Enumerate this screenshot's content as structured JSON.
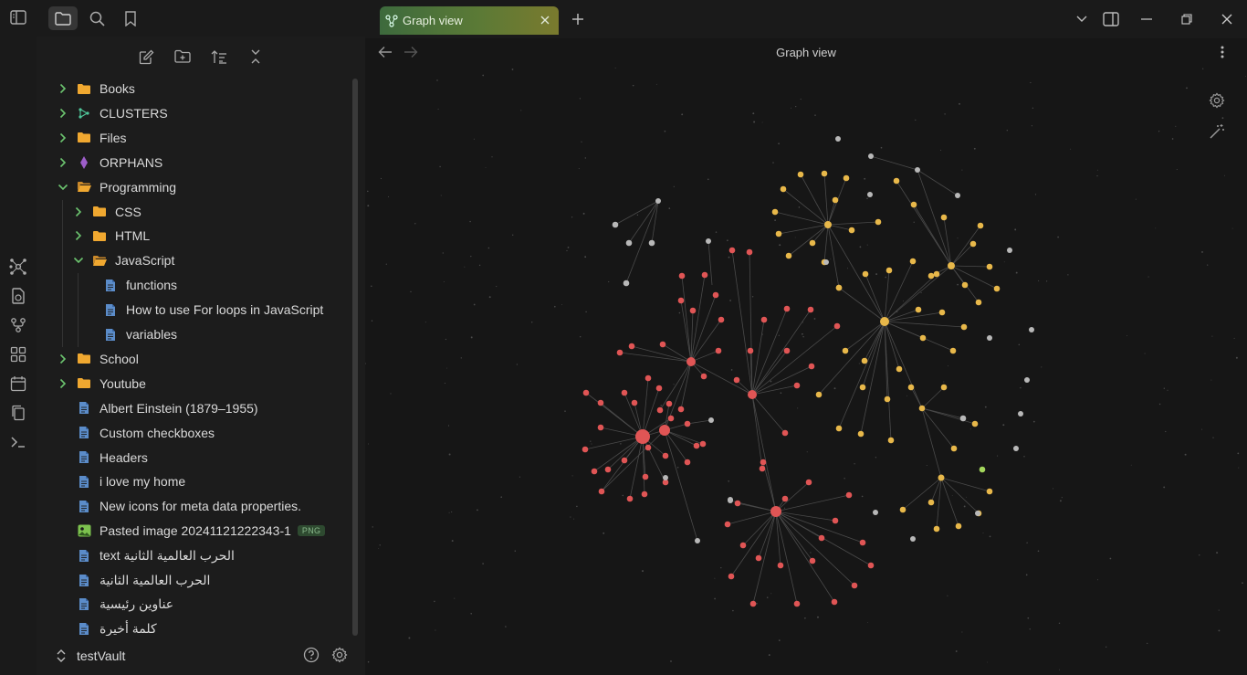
{
  "ribbon": {
    "icons": [
      "graph-view-icon",
      "file-recovery-icon",
      "canvas-icon",
      "templates-icon",
      "daily-notes-icon",
      "copy-icon",
      "command-palette-icon"
    ]
  },
  "topbar": {
    "icons": [
      "toggle-sidebar-icon",
      "files-icon",
      "search-icon",
      "bookmark-icon"
    ]
  },
  "nav_actions": [
    "new-note-icon",
    "new-folder-icon",
    "sort-icon",
    "collapse-all-icon"
  ],
  "tree": [
    {
      "label": "Books",
      "type": "folder",
      "expanded": false,
      "depth": 0
    },
    {
      "label": "CLUSTERS",
      "type": "cluster",
      "expanded": false,
      "depth": 0
    },
    {
      "label": "Files",
      "type": "folder",
      "expanded": false,
      "depth": 0
    },
    {
      "label": "ORPHANS",
      "type": "orphan",
      "expanded": false,
      "depth": 0
    },
    {
      "label": "Programming",
      "type": "folder",
      "expanded": true,
      "depth": 0
    },
    {
      "label": "CSS",
      "type": "folder",
      "expanded": false,
      "depth": 1
    },
    {
      "label": "HTML",
      "type": "folder",
      "expanded": false,
      "depth": 1
    },
    {
      "label": "JavaScript",
      "type": "folder",
      "expanded": true,
      "depth": 1
    },
    {
      "label": "functions",
      "type": "file",
      "depth": 2
    },
    {
      "label": "How to use For loops in JavaScript",
      "type": "file",
      "depth": 2
    },
    {
      "label": "variables",
      "type": "file",
      "depth": 2
    },
    {
      "label": "School",
      "type": "folder",
      "expanded": false,
      "depth": 0
    },
    {
      "label": "Youtube",
      "type": "folder",
      "expanded": false,
      "depth": 0
    },
    {
      "label": "Albert Einstein (1879–1955)",
      "type": "file",
      "depth": 0
    },
    {
      "label": "Custom checkboxes",
      "type": "file",
      "depth": 0
    },
    {
      "label": "Headers",
      "type": "file",
      "depth": 0
    },
    {
      "label": "i love my home",
      "type": "file",
      "depth": 0
    },
    {
      "label": "New icons for meta data properties.",
      "type": "file",
      "depth": 0
    },
    {
      "label": "Pasted image 20241121222343-1",
      "type": "image",
      "badge": "PNG",
      "depth": 0
    },
    {
      "label": "text الحرب العالمية الثانية",
      "type": "file",
      "depth": 0
    },
    {
      "label": "الحرب العالمية الثانية",
      "type": "file",
      "depth": 0
    },
    {
      "label": "عناوين رئيسية",
      "type": "file",
      "depth": 0
    },
    {
      "label": "كلمة أخيرة",
      "type": "file",
      "depth": 0
    }
  ],
  "vault": {
    "name": "testVault"
  },
  "tab": {
    "title": "Graph view",
    "icon": "graph-icon"
  },
  "view": {
    "title": "Graph view"
  },
  "colors": {
    "folder": "#f0a830",
    "file": "#5b8cc9",
    "node_red": "#e05555",
    "node_yellow": "#e8b84a",
    "node_gray": "#b8b8b8",
    "node_green": "#a3d65c",
    "edge": "#4a4a4a"
  }
}
